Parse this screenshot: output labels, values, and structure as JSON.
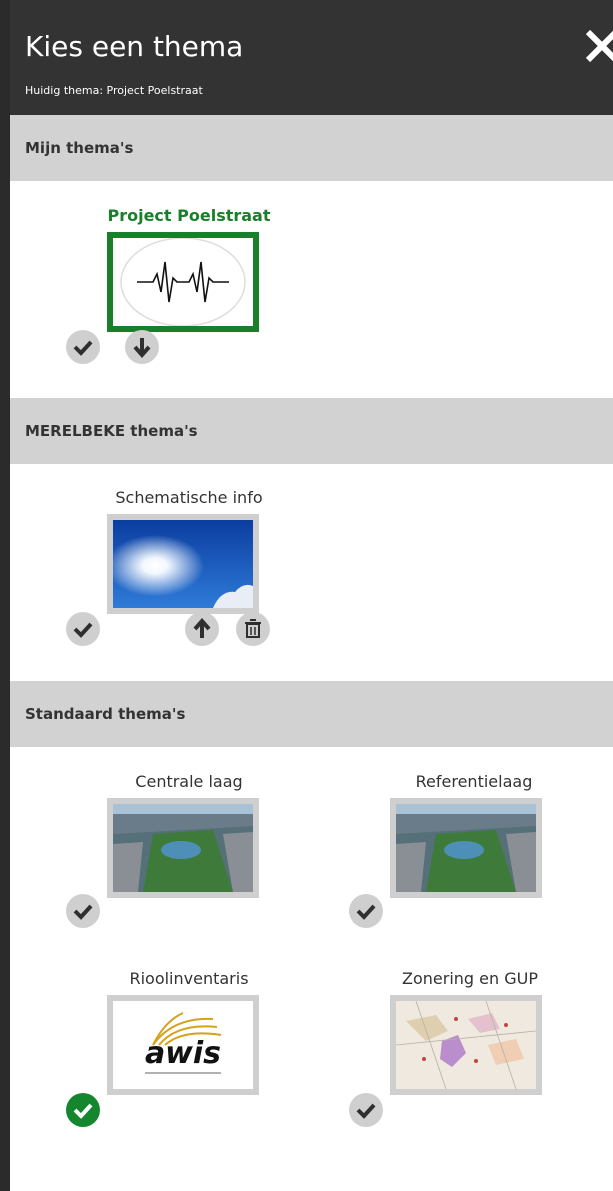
{
  "header": {
    "title": "Kies een thema",
    "subtitle": "Huidig thema: Project Poelstraat",
    "close_icon": "close-icon"
  },
  "sections": [
    {
      "title": "Mijn thema's",
      "cards": [
        {
          "title": "Project Poelstraat",
          "active": true,
          "thumbnail": "heartbeat-icon",
          "actions": [
            "check",
            "download"
          ]
        }
      ]
    },
    {
      "title": "MERELBEKE thema's",
      "cards": [
        {
          "title": "Schematische info",
          "thumbnail": "sky-sun",
          "actions": [
            "check",
            "upload",
            "delete"
          ]
        }
      ]
    },
    {
      "title": "Standaard thema's",
      "cards": [
        {
          "title": "Centrale laag",
          "thumbnail": "city-aerial",
          "actions": [
            "check"
          ]
        },
        {
          "title": "Referentielaag",
          "thumbnail": "city-aerial",
          "actions": [
            "check"
          ]
        },
        {
          "title": "Rioolinventaris",
          "thumbnail": "awis-logo",
          "logo_text": "awis",
          "actions": [
            "check-selected"
          ]
        },
        {
          "title": "Zonering en GUP",
          "thumbnail": "zoning-map",
          "actions": [
            "check"
          ]
        }
      ]
    }
  ],
  "colors": {
    "header_bg": "#333333",
    "section_bg": "#d2d2d2",
    "active_green": "#1a7f2a",
    "button_gray": "#cfcfcf",
    "button_green": "#14862e"
  }
}
